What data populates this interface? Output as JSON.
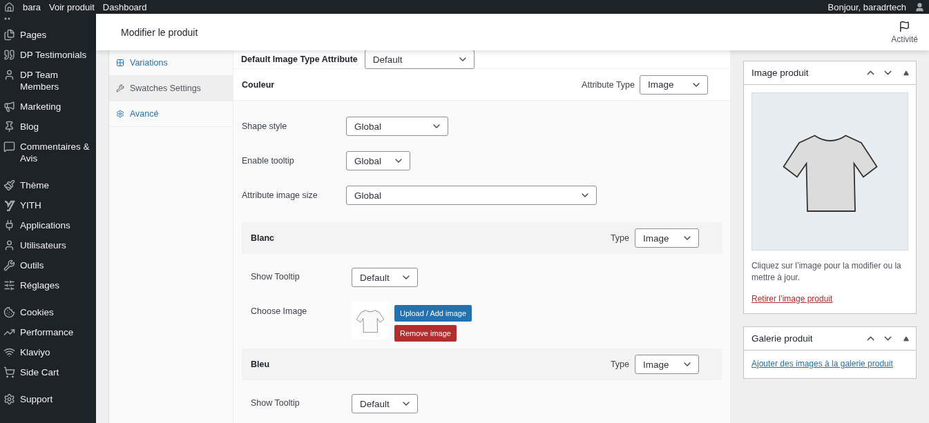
{
  "admin_bar": {
    "site": "bara",
    "links": [
      "Voir produit",
      "Dashboard"
    ],
    "greeting": "Bonjour, baradrtech"
  },
  "sidebar": {
    "groups": [
      [
        "Pages",
        "DP Testimonials",
        "DP Team Members",
        "Marketing",
        "Blog",
        "Commentaires & Avis"
      ],
      [
        "Thème",
        "YITH",
        "Applications",
        "Utilisateurs",
        "Outils",
        "Réglages"
      ],
      [
        "Cookies",
        "Performance",
        "Klaviyo",
        "Side Cart"
      ],
      [
        "Support"
      ]
    ]
  },
  "header": {
    "title": "Modifier le produit",
    "activity": "Activité"
  },
  "product_tabs": [
    {
      "label": "Variations",
      "selected": false
    },
    {
      "label": "Swatches Settings",
      "selected": true
    },
    {
      "label": "Avancé",
      "selected": false
    }
  ],
  "swatches": {
    "default_type": {
      "label": "Default Image Type Attribute",
      "value": "Default"
    },
    "attribute": {
      "name": "Couleur",
      "type_label": "Attribute Type",
      "type_value": "Image"
    },
    "settings": [
      {
        "label": "Shape style",
        "value": "Global"
      },
      {
        "label": "Enable tooltip",
        "value": "Global"
      },
      {
        "label": "Attribute image size",
        "value": "Global"
      }
    ],
    "terms": [
      {
        "name": "Blanc",
        "type_label": "Type",
        "type_value": "Image",
        "tooltip_label": "Show Tooltip",
        "tooltip_value": "Default",
        "image_label": "Choose Image",
        "upload": "Upload / Add image",
        "remove": "Remove image"
      },
      {
        "name": "Bleu",
        "type_label": "Type",
        "type_value": "Image",
        "tooltip_label": "Show Tooltip",
        "tooltip_value": "Default"
      }
    ]
  },
  "image_box": {
    "title": "Image produit",
    "hint": "Cliquez sur l’image pour la modifier ou la mettre à jour.",
    "remove_link": "Retirer l’image produit"
  },
  "gallery_box": {
    "title": "Galerie produit",
    "add_link": "Ajouter des images à la galerie produit"
  }
}
